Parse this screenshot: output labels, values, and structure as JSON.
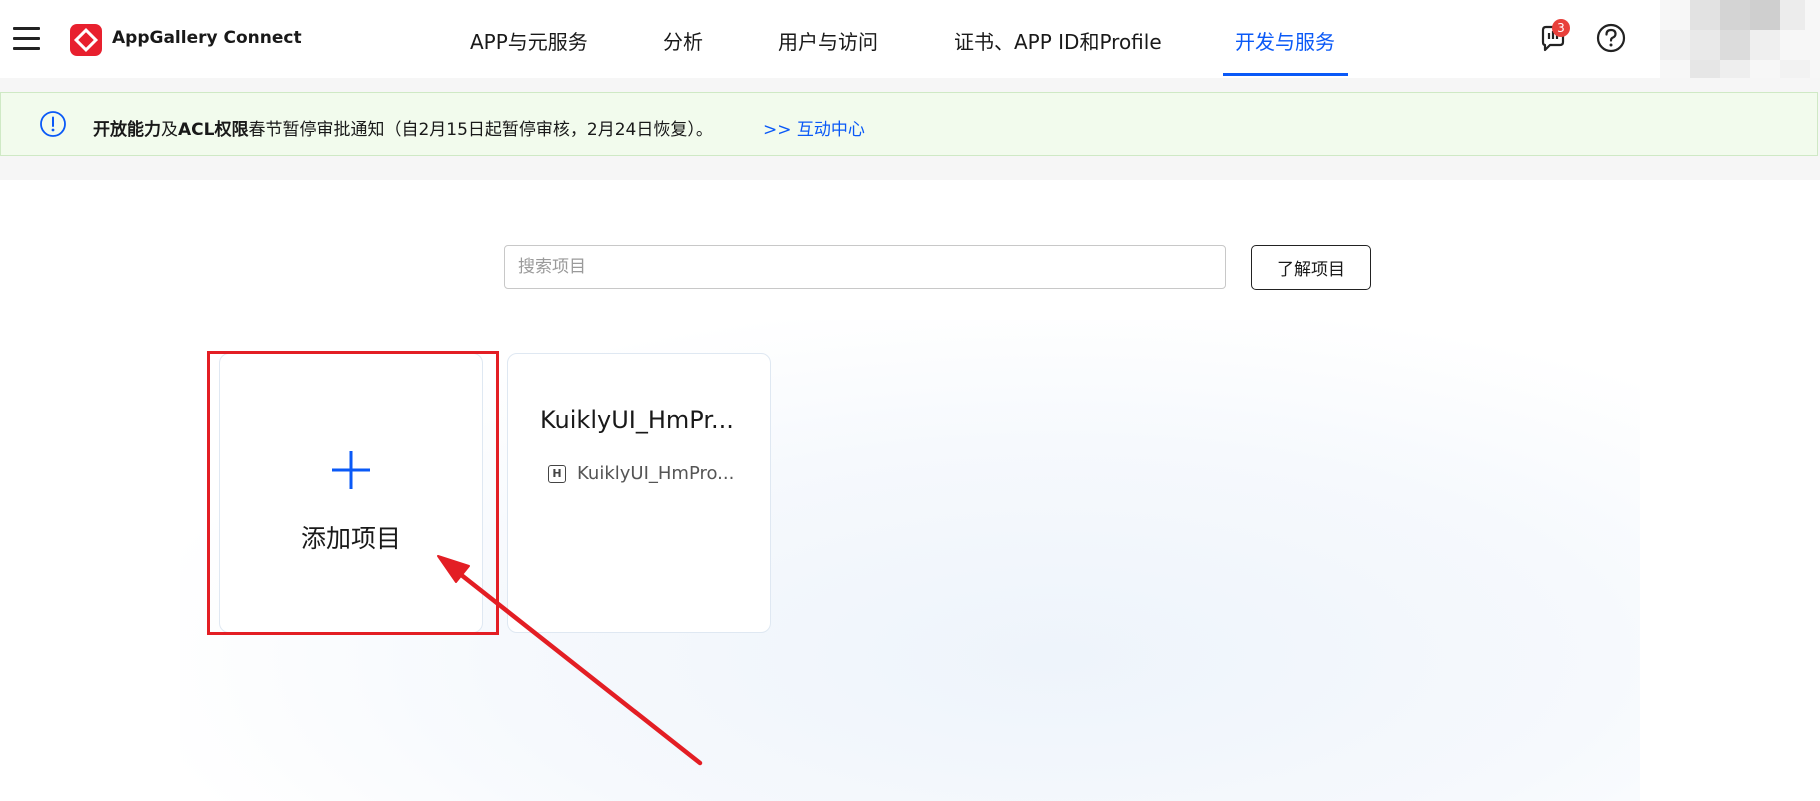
{
  "header": {
    "logo_text": "AppGallery Connect",
    "nav_tabs": [
      {
        "label": "APP与元服务",
        "active": false
      },
      {
        "label": "分析",
        "active": false
      },
      {
        "label": "用户与访问",
        "active": false
      },
      {
        "label": "证书、APP ID和Profile",
        "active": false
      },
      {
        "label": "开发与服务",
        "active": true
      }
    ],
    "notification_count": "3",
    "accent_color": "#0a59f7",
    "brand_color": "#e8202e"
  },
  "notice": {
    "bold_1": "开放能力",
    "text_1": "及",
    "bold_2": "ACL权限",
    "text_2": "春节暂停审批通知（自2月15日起暂停审核，2月24日恢复）。",
    "link": ">> 互动中心",
    "icon": "info-icon"
  },
  "search": {
    "placeholder": "搜索项目",
    "value": ""
  },
  "learn_button": "了解项目",
  "cards": {
    "add_label": "添加项目",
    "project": {
      "name": "KuiklyUI_HmPr...",
      "app_icon_letter": "H",
      "app_name": "KuiklyUI_HmPro..."
    }
  },
  "annotation": {
    "color": "#e31e24"
  }
}
